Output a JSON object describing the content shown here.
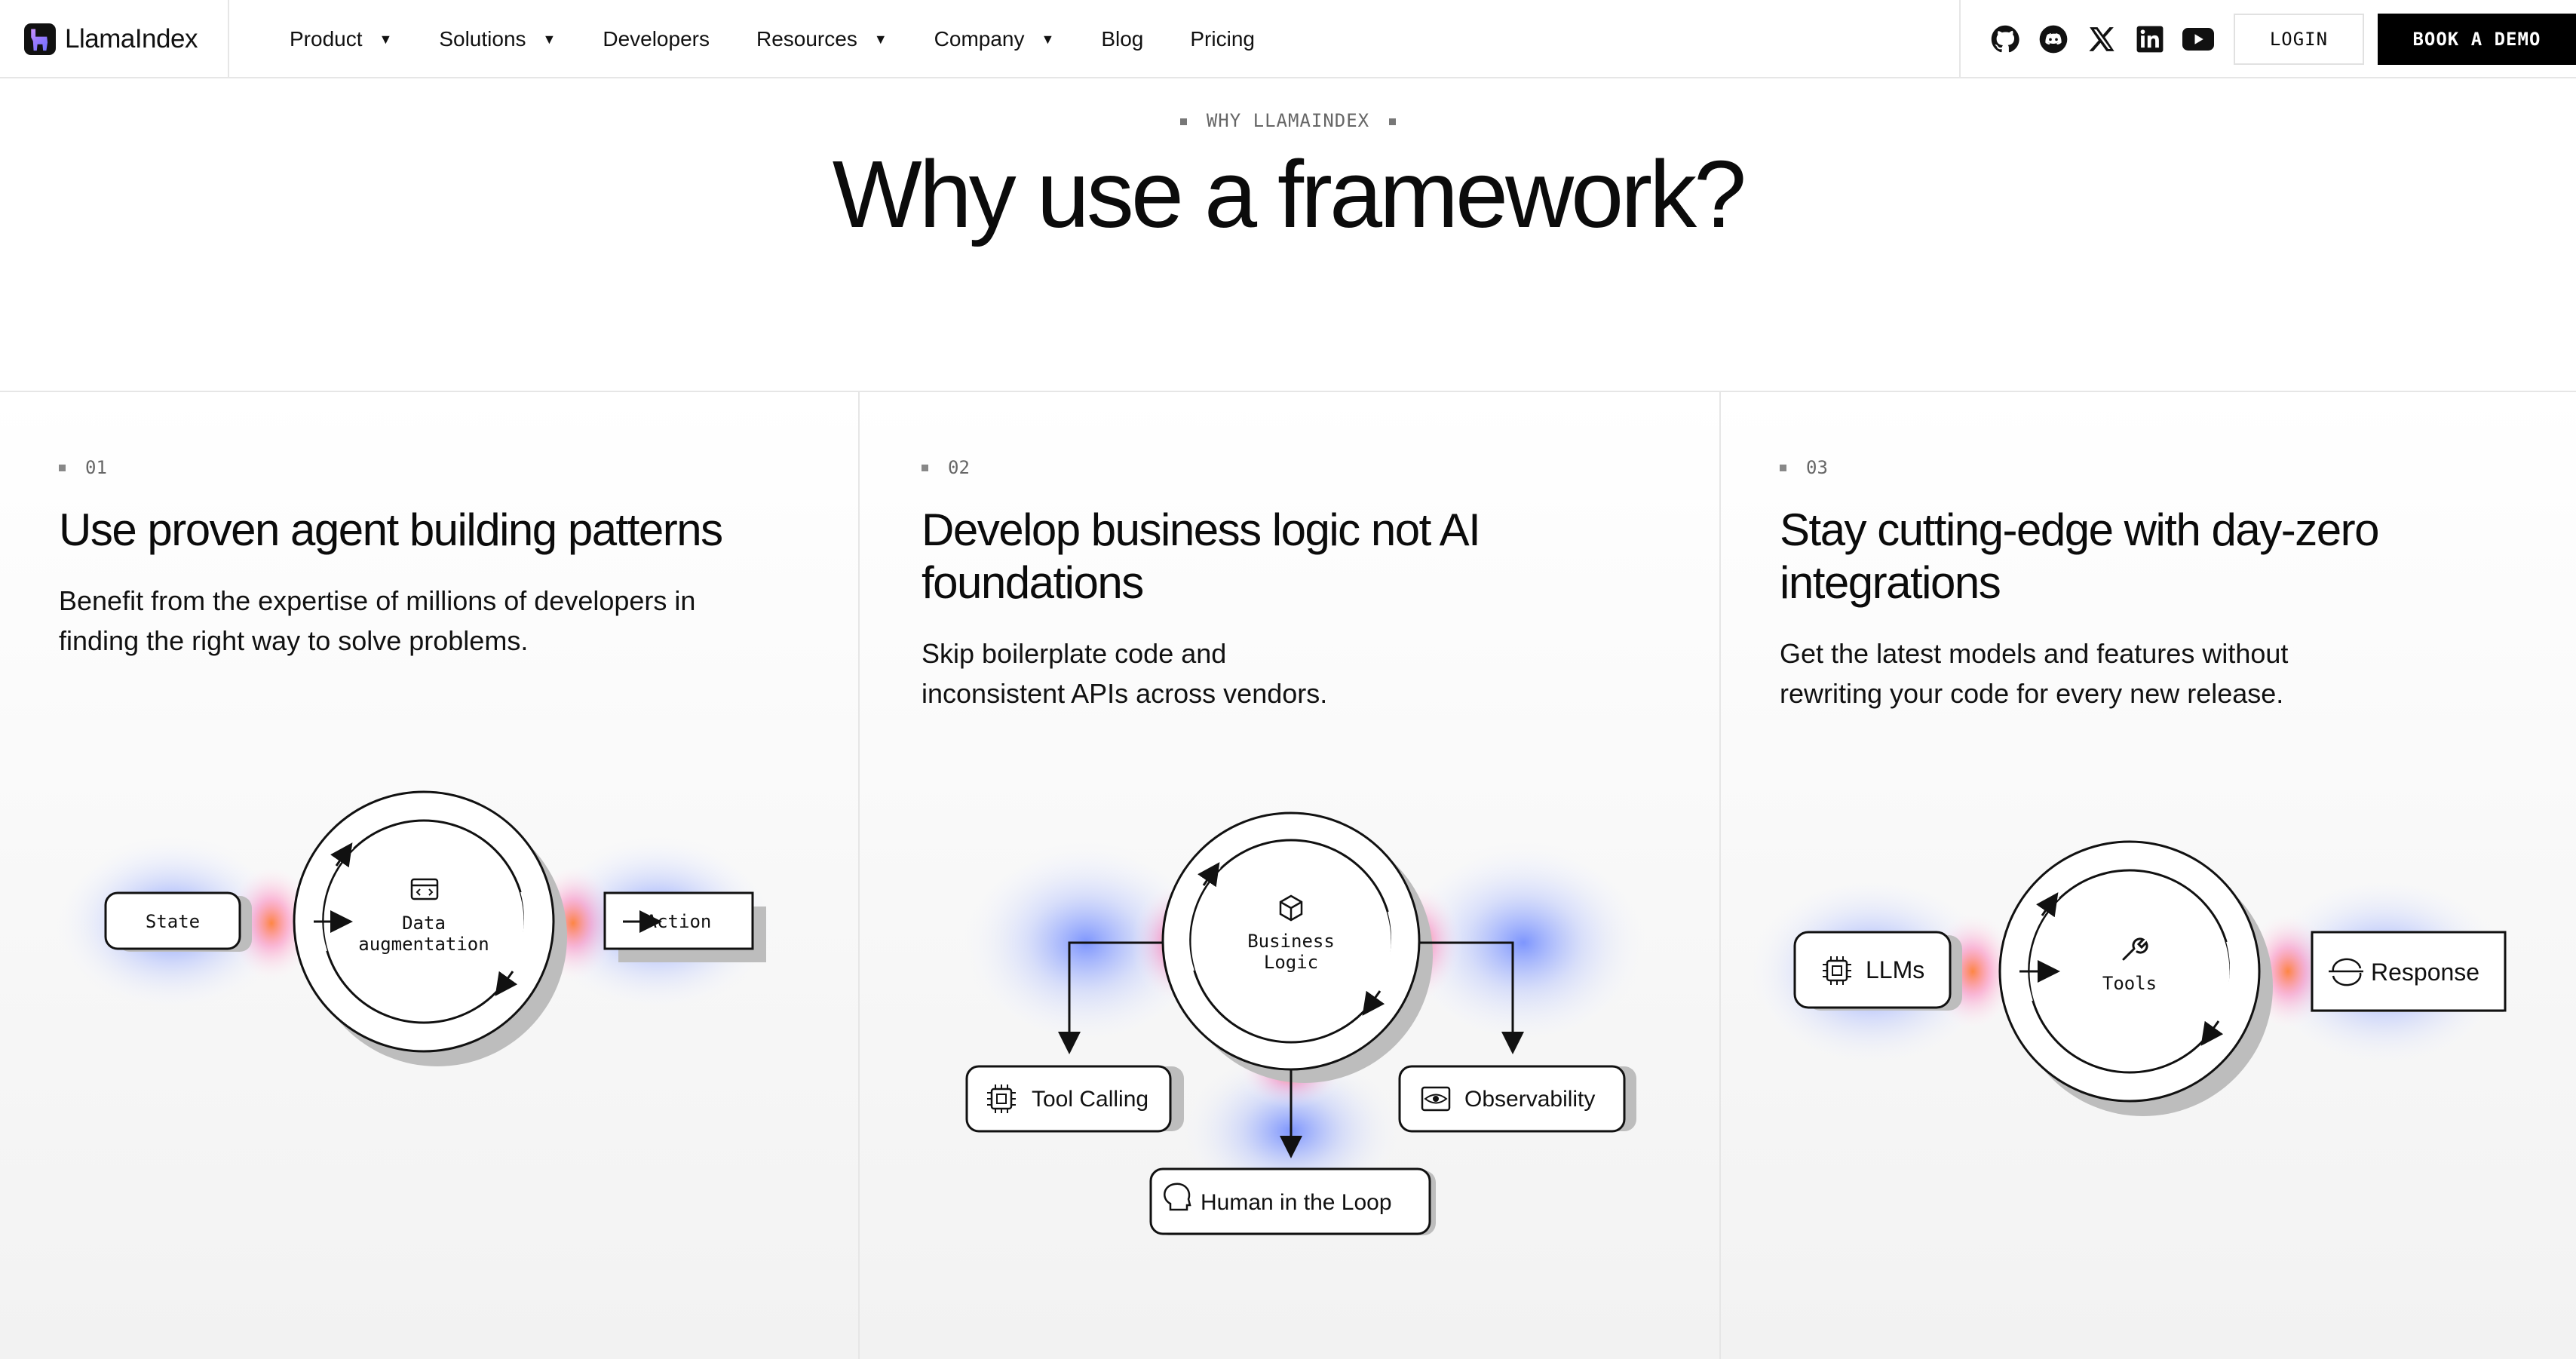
{
  "brand": {
    "name": "LlamaIndex"
  },
  "nav": {
    "items": [
      {
        "label": "Product",
        "dropdown": true
      },
      {
        "label": "Solutions",
        "dropdown": true
      },
      {
        "label": "Developers",
        "dropdown": false
      },
      {
        "label": "Resources",
        "dropdown": true
      },
      {
        "label": "Company",
        "dropdown": true
      },
      {
        "label": "Blog",
        "dropdown": false
      },
      {
        "label": "Pricing",
        "dropdown": false
      }
    ],
    "social_icons": [
      "github-icon",
      "discord-icon",
      "x-icon",
      "linkedin-icon",
      "youtube-icon"
    ],
    "login_label": "LOGIN",
    "demo_label": "BOOK A DEMO"
  },
  "hero": {
    "eyebrow": "WHY LLAMAINDEX",
    "title": "Why use a framework?"
  },
  "cards": [
    {
      "number": "01",
      "title": "Use proven agent building patterns",
      "description": "Benefit from the expertise of millions of developers in finding the right way to solve problems.",
      "diagram": {
        "left": "State",
        "center": "Data augmentation",
        "right": "Action",
        "center_icon": "browser-code-icon"
      }
    },
    {
      "number": "02",
      "title": "Develop business logic not AI foundations",
      "description": "Skip boilerplate code and inconsistent APIs across vendors.",
      "diagram": {
        "center": "Business Logic",
        "center_icon": "cube-icon",
        "nodes": [
          "Tool Calling",
          "Observability",
          "Human in the Loop"
        ]
      }
    },
    {
      "number": "03",
      "title": "Stay cutting-edge with day-zero integrations",
      "description": "Get the latest models and features without rewriting your code for every new release.",
      "diagram": {
        "left": "LLMs",
        "center": "Tools",
        "right": "Response",
        "center_icon": "wrench-icon"
      }
    }
  ],
  "colors": {
    "accent_black": "#000000",
    "glow_blue": "#6f8cff",
    "glow_orange": "#ff8a3d",
    "glow_pink": "#ff6fb0"
  }
}
